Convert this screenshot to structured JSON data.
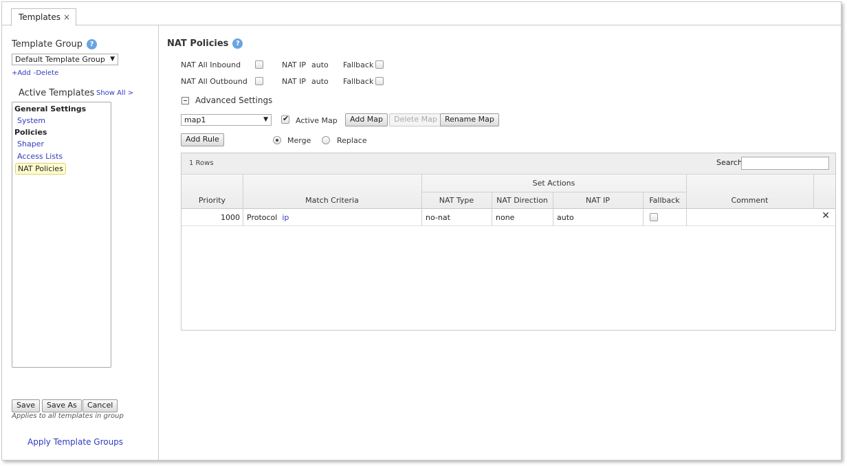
{
  "tab": {
    "label": "Templates",
    "close": "×"
  },
  "sidebar": {
    "template_group_label": "Template Group",
    "help": "?",
    "template_group_value": "Default Template Group",
    "add_label": "+Add",
    "delete_label": "-Delete",
    "active_templates_label": "Active Templates",
    "show_all": "Show All >",
    "tree": {
      "group1": "General Settings",
      "item_system": "System",
      "group2": "Policies",
      "item_shaper": "Shaper",
      "item_access_lists": "Access Lists",
      "item_nat_policies": "NAT Policies"
    },
    "save": "Save",
    "save_as": "Save As",
    "cancel": "Cancel",
    "applies_note": "Applies to all templates in group",
    "apply_groups": "Apply Template Groups"
  },
  "main": {
    "title": "NAT Policies",
    "help": "?",
    "nat_inbound_label": "NAT All Inbound",
    "nat_outbound_label": "NAT All Outbound",
    "nat_ip_label": "NAT IP",
    "nat_ip_value_1": "auto",
    "nat_ip_value_2": "auto",
    "fallback_label": "Fallback",
    "advanced_label": "Advanced Settings",
    "map_value": "map1",
    "active_map_label": "Active Map",
    "add_map": "Add Map",
    "delete_map": "Delete Map",
    "rename_map": "Rename Map",
    "add_rule": "Add Rule",
    "merge_label": "Merge",
    "replace_label": "Replace"
  },
  "grid": {
    "rows_count": "1 Rows",
    "search_label": "Search",
    "columns": {
      "priority": "Priority",
      "match_criteria": "Match Criteria",
      "set_actions": "Set Actions",
      "nat_type": "NAT Type",
      "nat_direction": "NAT Direction",
      "nat_ip": "NAT IP",
      "fallback": "Fallback",
      "comment": "Comment"
    },
    "rows": [
      {
        "priority": "1000",
        "match_prefix": "Protocol",
        "match_value": "ip",
        "nat_type": "no-nat",
        "nat_direction": "none",
        "nat_ip": "auto",
        "comment": "",
        "delete": "✕"
      }
    ]
  }
}
